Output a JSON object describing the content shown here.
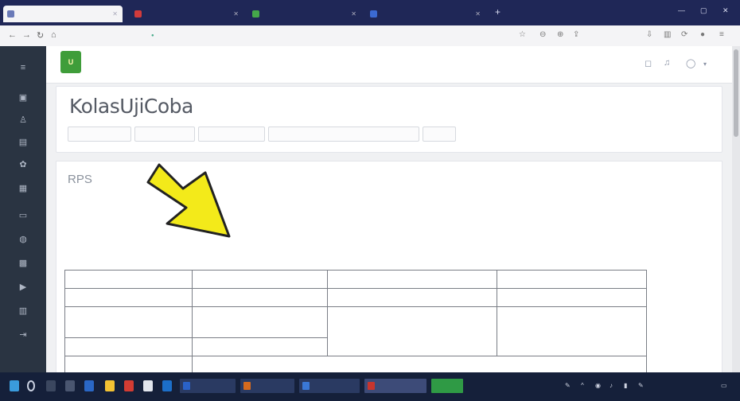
{
  "browser": {
    "tabs": [
      {
        "label": "",
        "color": "#6a7ab8"
      },
      {
        "label": "",
        "color": "#d23b3b"
      },
      {
        "label": "",
        "color": "#45a84a"
      },
      {
        "label": "",
        "color": "#3b6ad2"
      }
    ],
    "url": ""
  },
  "site": {
    "logo_text_top": "",
    "logo_text_bottom": "",
    "menu": []
  },
  "course": {
    "title": "KolasUjiCoba",
    "tabs": []
  },
  "content": {
    "heading": "RPS",
    "doc_title": "",
    "doc_subtitle": "",
    "table": [
      [
        "",
        "",
        "",
        ""
      ],
      [
        "",
        "",
        "",
        ""
      ],
      [
        "",
        "",
        "",
        ""
      ],
      [
        "",
        "",
        "",
        ""
      ],
      [
        "",
        "",
        "",
        ""
      ]
    ]
  },
  "taskbar": {
    "apps": [
      {
        "label": "",
        "color": "#2a62c8"
      },
      {
        "label": "",
        "color": "#d66a1e"
      },
      {
        "label": "",
        "color": "#3a78d6"
      },
      {
        "label": "",
        "color": "#c8352e"
      },
      {
        "label": "",
        "color": "#2f9a45"
      }
    ],
    "clock_time": "",
    "clock_date": ""
  },
  "colors": {
    "annotation_arrow": "#f3ea1a",
    "browser_tabbar": "#1f2757",
    "sidebar": "#2a3442",
    "logo_green": "#3f9d3a",
    "logo_gold": "#caa21b"
  }
}
